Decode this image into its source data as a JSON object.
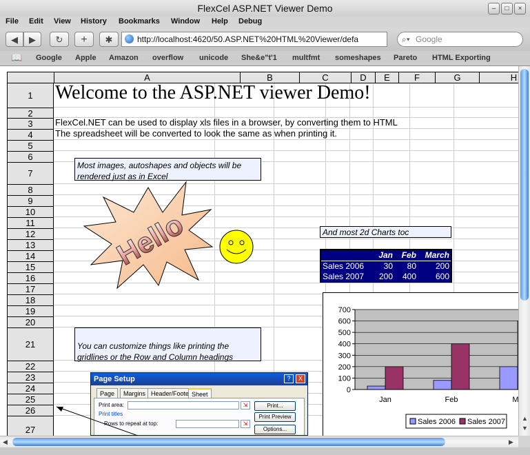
{
  "window": {
    "title": "FlexCel ASP.NET Viewer Demo"
  },
  "menu": [
    "File",
    "Edit",
    "View",
    "History",
    "Bookmarks",
    "Window",
    "Help",
    "Debug"
  ],
  "toolbar": {
    "url": "http://localhost:4620/50.ASP.NET%20HTML%20Viewer/defa",
    "search_placeholder": "Google"
  },
  "bookmarks": [
    "Google",
    "Apple",
    "Amazon",
    "overflow",
    "unicode",
    "She&e\"t'1",
    "multfmt",
    "someshapes",
    "Pareto",
    "HTML Exporting"
  ],
  "sheet": {
    "columns": [
      "A",
      "B",
      "C",
      "D",
      "E",
      "F",
      "G",
      "H"
    ],
    "rows": [
      "1",
      "2",
      "3",
      "4",
      "5",
      "6",
      "7",
      "8",
      "9",
      "10",
      "11",
      "12",
      "13",
      "14",
      "15",
      "16",
      "17",
      "18",
      "19",
      "20",
      "21",
      "22",
      "23",
      "24",
      "25",
      "26",
      "27"
    ],
    "title": "Welcome to the ASP.NET viewer Demo!",
    "line3": "FlexCel.NET can be used to display xls files in a browser, by converting them to HTML",
    "line4": "The spreadsheet will be converted to look the same as when printing it.",
    "box_images": "Most images, autoshapes and objects will be rendered just as in Excel",
    "box_images_line1": "Most images, autoshapes and objects will be",
    "box_images_line2": "rendered just as in Excel",
    "hello_shape": "Hello",
    "charts_note": "And most 2d Charts toc",
    "box_customize_line1": "You can customize things like printing the",
    "box_customize_line2": "gridlines or the Row and Column headings"
  },
  "sales_table": {
    "headers": [
      "",
      "Jan",
      "Feb",
      "March"
    ],
    "rows": [
      {
        "label": "Sales 2006",
        "values": [
          "30",
          "80",
          "200"
        ]
      },
      {
        "label": "Sales 2007",
        "values": [
          "200",
          "400",
          "600"
        ]
      }
    ]
  },
  "page_setup": {
    "title": "Page Setup",
    "tabs": [
      "Page",
      "Margins",
      "Header/Footer",
      "Sheet"
    ],
    "print_area_label": "Print area:",
    "print_titles_label": "Print titles",
    "rows_repeat_label": "Rows to repeat at top:",
    "buttons": [
      "Print...",
      "Print Preview",
      "Options..."
    ],
    "help_glyph": "?",
    "close_glyph": "X"
  },
  "chart_data": {
    "type": "bar",
    "categories": [
      "Jan",
      "Feb",
      "Ma"
    ],
    "series": [
      {
        "name": "Sales 2006",
        "values": [
          30,
          80,
          200
        ],
        "color": "#9999ff"
      },
      {
        "name": "Sales 2007",
        "values": [
          200,
          400,
          600
        ],
        "color": "#993366"
      }
    ],
    "yticks": [
      "0",
      "100",
      "200",
      "300",
      "400",
      "500",
      "600",
      "700"
    ],
    "ylim": [
      0,
      700
    ],
    "grid": true,
    "legend": "bottom",
    "plot_bg": "#c0c0c0"
  },
  "colors": {
    "sales_table_bg": "#000080",
    "box_bg": "#eef2ff",
    "header_bg": "#e3e3e3",
    "accent_blue": "#3c7fd8"
  }
}
